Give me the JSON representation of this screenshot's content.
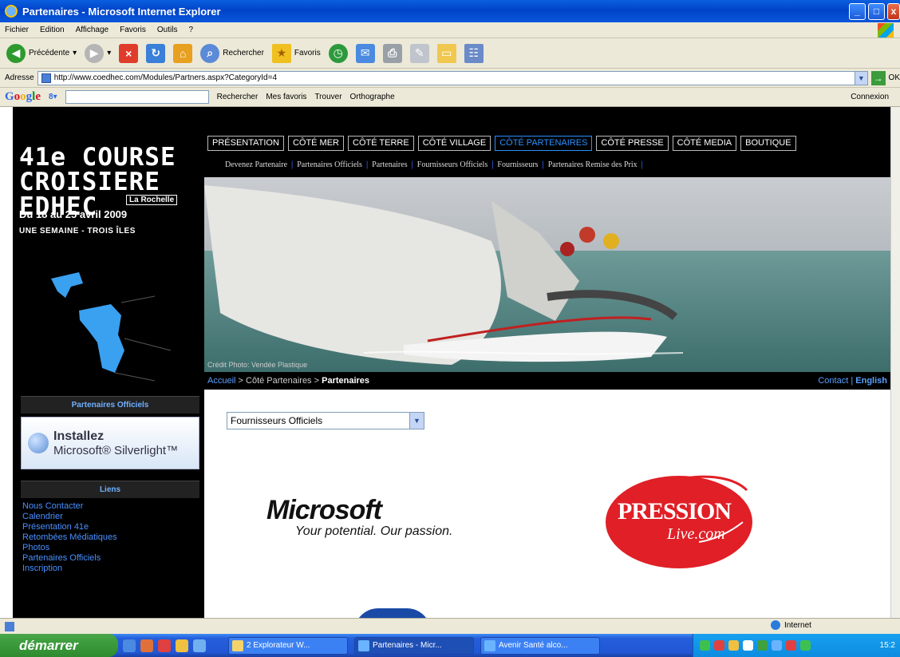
{
  "window": {
    "title": "Partenaires - Microsoft Internet Explorer"
  },
  "menu": [
    "Fichier",
    "Edition",
    "Affichage",
    "Favoris",
    "Outils",
    "?"
  ],
  "toolbar": {
    "back_label": "Précédente",
    "search_label": "Rechercher",
    "favorites_label": "Favoris"
  },
  "address": {
    "label": "Adresse",
    "url": "http://www.coedhec.com/Modules/Partners.aspx?CategoryId=4",
    "go_label": "OK"
  },
  "google_bar": {
    "logo": "Google",
    "search_btn": "Rechercher",
    "favorites": "Mes favoris",
    "find": "Trouver",
    "spell": "Orthographe",
    "login": "Connexion"
  },
  "site": {
    "logo": {
      "line1": "41e COURSE",
      "line2": "CROISIERE",
      "line3": "EDHEC",
      "city": "La Rochelle",
      "dates": "Du 18 au 25 avril 2009",
      "tagline": "UNE SEMAINE - TROIS ÎLES"
    },
    "nav": [
      {
        "label": "PRÉSENTATION",
        "active": false
      },
      {
        "label": "CÔTÉ MER",
        "active": false
      },
      {
        "label": "CÔTÉ TERRE",
        "active": false
      },
      {
        "label": "CÔTÉ VILLAGE",
        "active": false
      },
      {
        "label": "CÔTÉ PARTENAIRES",
        "active": true
      },
      {
        "label": "CÔTÉ PRESSE",
        "active": false
      },
      {
        "label": "CÔTÉ MEDIA",
        "active": false
      },
      {
        "label": "BOUTIQUE",
        "active": false
      }
    ],
    "subnav": [
      "Devenez Partenaire",
      "Partenaires Officiels",
      "Partenaires",
      "Fournisseurs Officiels",
      "Fournisseurs",
      "Partenaires Remise des Prix"
    ],
    "hero_credit": "Crédit Photo: Vendée Plastique",
    "breadcrumb": {
      "home": "Accueil",
      "sep": " > ",
      "level1": "Côté Partenaires",
      "current": "Partenaires",
      "contact": "Contact",
      "pipe": " | ",
      "english": "English"
    },
    "sidebar": {
      "official_header": "Partenaires Officiels",
      "silverlight_line1": "Installez",
      "silverlight_line2": "Microsoft® Silverlight™",
      "links_header": "Liens",
      "links": [
        "Nous Contacter",
        "Calendrier",
        "Présentation 41e",
        "Retombées Médiatiques",
        "Photos",
        "Partenaires Officiels",
        "Inscription"
      ]
    },
    "content": {
      "category_selected": "Fournisseurs Officiels",
      "microsoft_name": "Microsoft",
      "microsoft_tagline": "Your potential. Our passion.",
      "pression_line1": "PRESSION",
      "pression_line2": "Live.com"
    }
  },
  "status": {
    "zone": "Internet"
  },
  "taskbar": {
    "start": "démarrer",
    "items": [
      {
        "label": "2 Explorateur W...",
        "active": false
      },
      {
        "label": "Partenaires - Micr...",
        "active": true
      },
      {
        "label": "Avenir Santé alco...",
        "active": false
      }
    ],
    "clock": "15:2"
  }
}
